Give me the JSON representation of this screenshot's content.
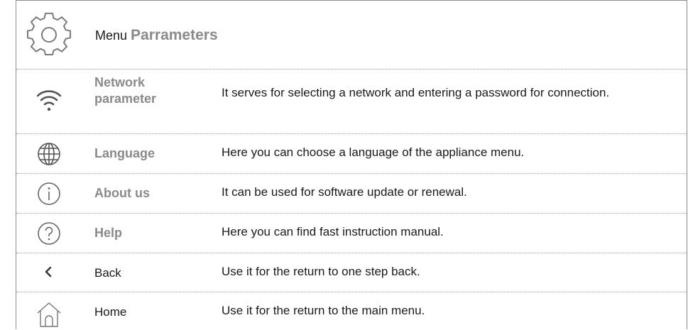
{
  "header": {
    "menu_word": "Menu",
    "title_strong": "Parrameters",
    "icon": "gear-icon"
  },
  "rows": [
    {
      "icon": "wifi-icon",
      "name_line1": "Network",
      "name_line2": "parameter",
      "description": "It serves for selecting a network and entering a password for connection."
    },
    {
      "icon": "globe-icon",
      "name": "Language",
      "description": "Here you can choose a language of the appliance menu."
    },
    {
      "icon": "info-icon",
      "name": "About us",
      "description": "It can be used for software update or renewal."
    },
    {
      "icon": "help-icon",
      "name": "Help",
      "description": "Here you can find fast instruction manual."
    },
    {
      "icon": "chevron-left-icon",
      "name": "Back",
      "description": "Use it for the return to one step back."
    },
    {
      "icon": "home-icon",
      "name": "Home",
      "description": "Use it for the return to the main menu."
    }
  ],
  "colors": {
    "icon_stroke": "#7a7a7a",
    "label_gray": "#8a8a8a",
    "text": "#1a1a1a",
    "divider": "#9a9a9a"
  }
}
